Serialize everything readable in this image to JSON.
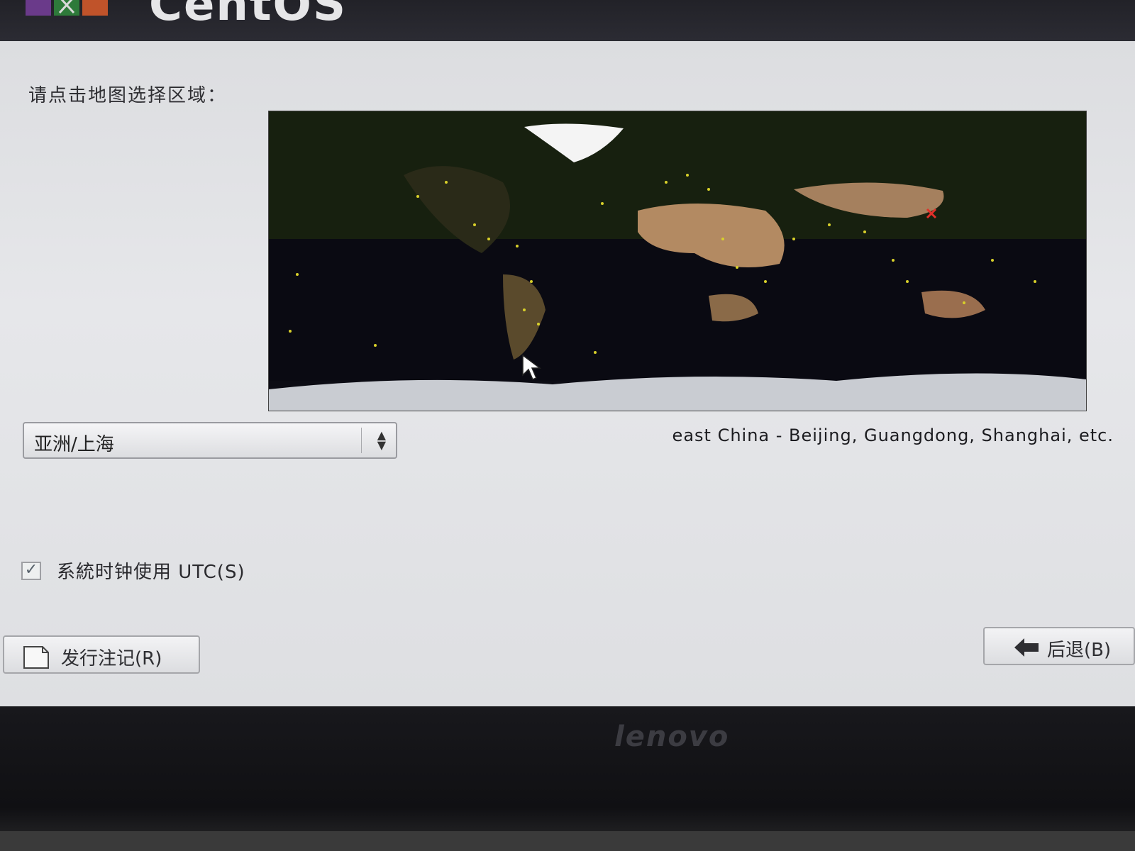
{
  "header": {
    "brand_text": "CentOS",
    "logo_icon": "centos-logo-icon"
  },
  "main": {
    "prompt": "请点击地图选择区域：",
    "map": {
      "icon": "world-map",
      "selected_marker_color": "#e0302a",
      "city_dot_color": "#d8d02a"
    },
    "timezone_select": {
      "value": "亚洲/上海"
    },
    "timezone_description": "east China - Beijing, Guangdong, Shanghai, etc.",
    "utc_checkbox": {
      "label": "系統时钟使用 UTC(S)",
      "checked": true
    }
  },
  "footer": {
    "release_notes_label": "发行注记(R)",
    "back_label": "后退(B)"
  },
  "bezel": {
    "brand": "lenovo"
  }
}
